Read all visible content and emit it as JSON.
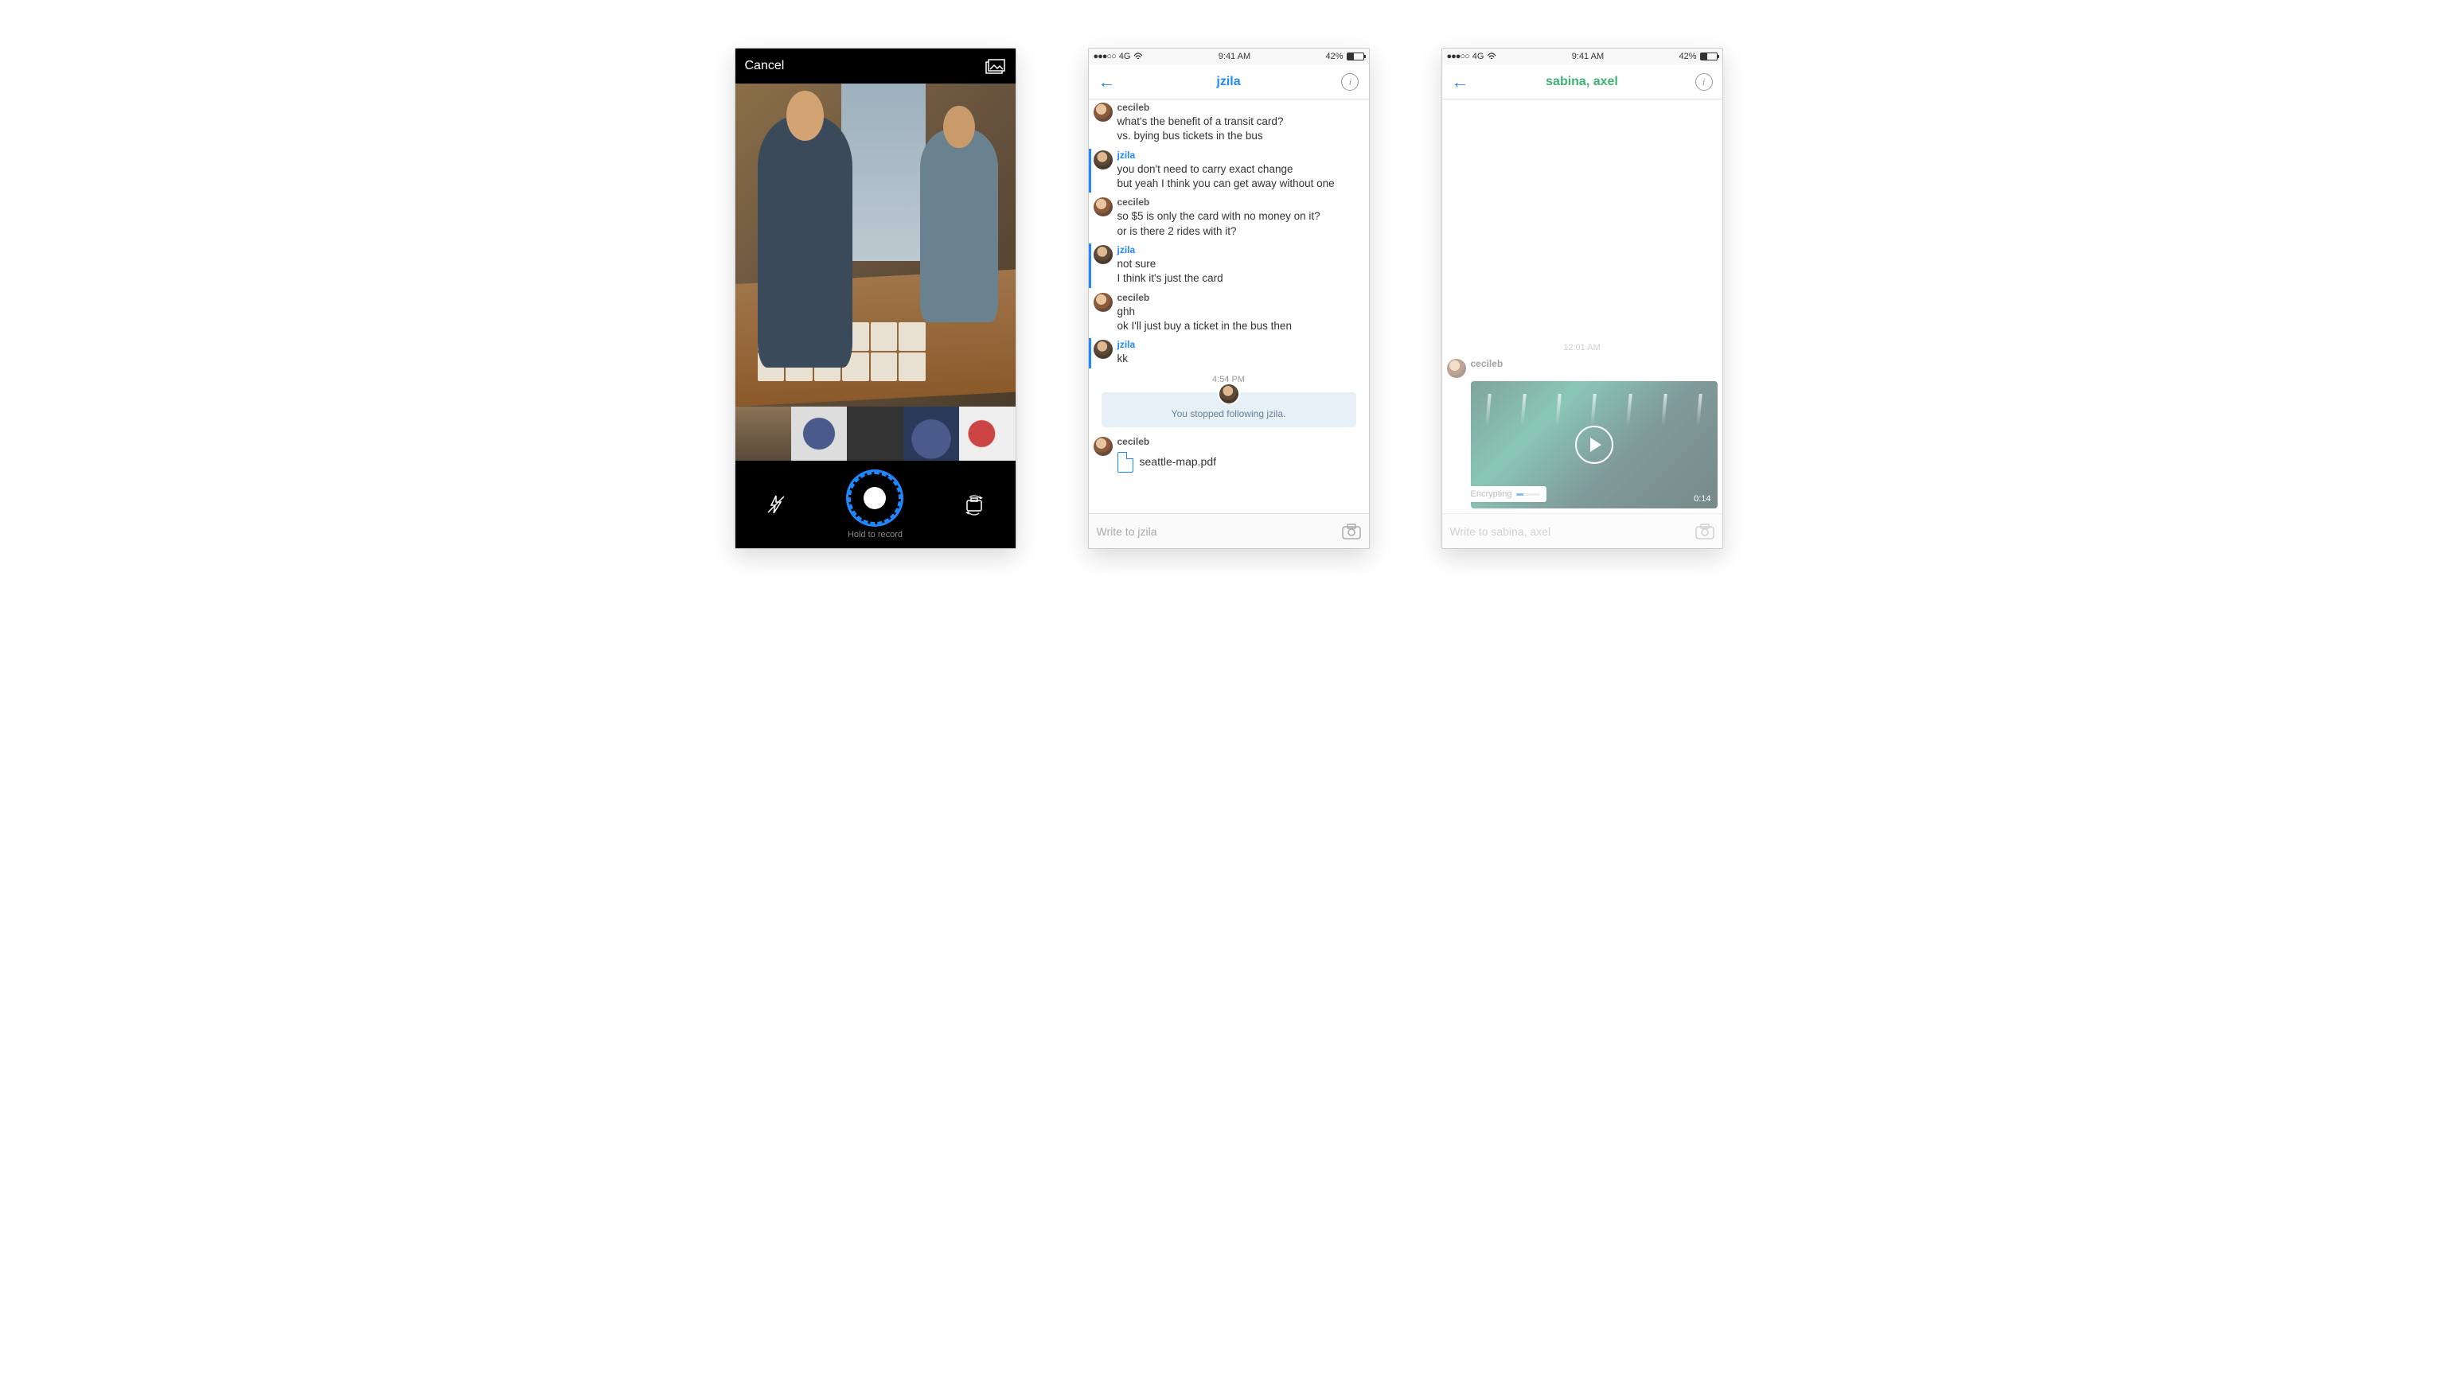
{
  "camera": {
    "cancel": "Cancel",
    "hold_label": "Hold to record",
    "icons": {
      "gallery": "gallery-icon",
      "flash": "flash-off-icon",
      "shutter": "shutter-button",
      "switch": "switch-camera-icon"
    }
  },
  "status": {
    "carrier_dots": "●●●○○",
    "network": "4G",
    "time": "9:41 AM",
    "battery_pct": "42%"
  },
  "chat1": {
    "title": "jzila",
    "compose_placeholder": "Write to jzila",
    "timestamp": "4:54 PM",
    "system_event": "You stopped following jzila.",
    "messages": [
      {
        "user": "cecileb",
        "role": "dark",
        "lines": [
          "what's the benefit of a transit card?",
          "vs. bying bus tickets in the bus"
        ]
      },
      {
        "user": "jzila",
        "role": "blue",
        "lines": [
          "you don't need to carry exact change",
          "but yeah I think you can get away without one"
        ]
      },
      {
        "user": "cecileb",
        "role": "dark",
        "lines": [
          "so $5 is only the card with no money on it?",
          "or is there 2 rides with it?"
        ]
      },
      {
        "user": "jzila",
        "role": "blue",
        "lines": [
          "not sure",
          "I think it's just the card"
        ]
      },
      {
        "user": "cecileb",
        "role": "dark",
        "lines": [
          "ghh",
          "ok I'll just buy a ticket in the bus then"
        ]
      },
      {
        "user": "jzila",
        "role": "blue",
        "lines": [
          "kk"
        ]
      }
    ],
    "attachment": {
      "user": "cecileb",
      "filename": "seattle-map.pdf"
    }
  },
  "chat2": {
    "title": "sabina, axel",
    "compose_placeholder": "Write to sabina, axel",
    "timestamp": "12:01 AM",
    "sender": "cecileb",
    "video_duration": "0:14",
    "encrypting_label": "Encrypting"
  }
}
